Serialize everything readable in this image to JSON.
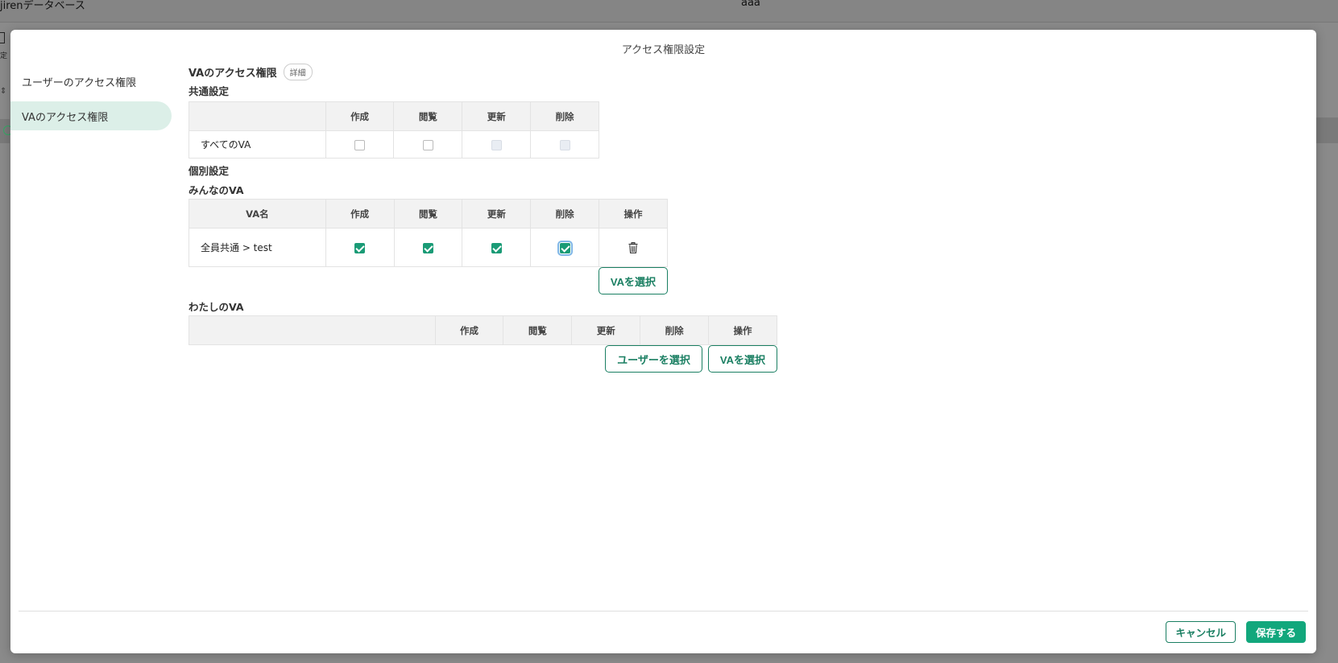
{
  "background": {
    "db_title": "jirenデータベース",
    "field_value": "aaa",
    "side_label": "定",
    "sort_icon": "sort-icon"
  },
  "modal": {
    "title": "アクセス権限設定",
    "nav": {
      "user_access": "ユーザーのアクセス権限",
      "va_access": "VAのアクセス権限"
    },
    "va_access": {
      "heading": "VAのアクセス権限",
      "detail_badge": "詳細",
      "common": {
        "heading": "共通設定",
        "columns": [
          "",
          "作成",
          "閲覧",
          "更新",
          "削除"
        ],
        "rows": [
          {
            "name": "すべてのVA",
            "create": "unchecked",
            "view": "unchecked",
            "update": "disabled",
            "delete": "disabled"
          }
        ]
      },
      "individual": {
        "heading": "個別設定",
        "everyone": {
          "heading": "みんなのVA",
          "columns": [
            "VA名",
            "作成",
            "閲覧",
            "更新",
            "削除",
            "操作"
          ],
          "rows": [
            {
              "name": "全員共通 > test",
              "create": "checked",
              "view": "checked",
              "update": "checked",
              "delete": "checked",
              "action_icon": "trash-icon"
            }
          ],
          "select_va_button": "VAを選択"
        },
        "mine": {
          "heading": "わたしのVA",
          "columns": [
            "",
            "作成",
            "閲覧",
            "更新",
            "削除",
            "操作"
          ],
          "select_user_button": "ユーザーを選択",
          "select_va_button": "VAを選択"
        }
      }
    },
    "footer": {
      "cancel": "キャンセル",
      "save": "保存する"
    }
  },
  "colors": {
    "accent": "#12a77c",
    "accent_text": "#1a7f62",
    "active_nav_bg": "#dcefe8"
  }
}
